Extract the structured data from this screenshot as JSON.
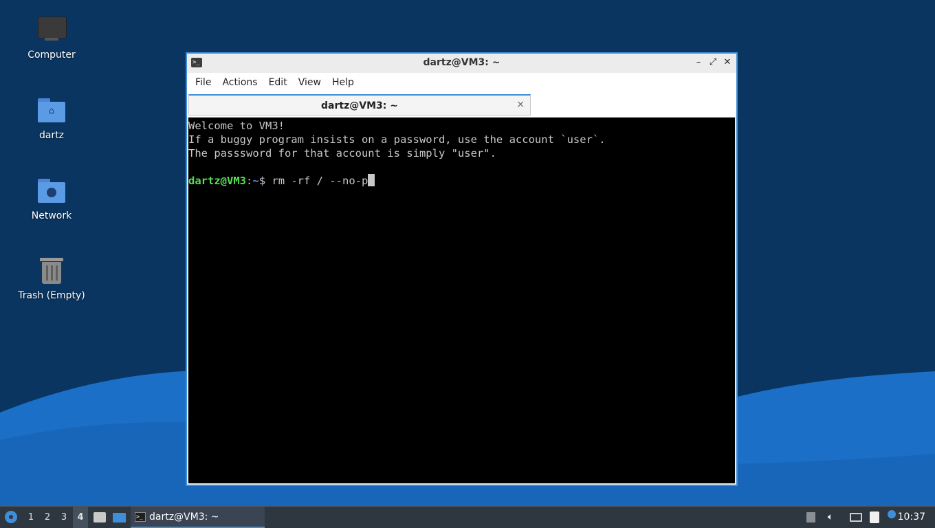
{
  "desktop": {
    "icons": [
      {
        "label": "Computer",
        "icon": "computer-icon"
      },
      {
        "label": "dartz",
        "icon": "home-folder-icon"
      },
      {
        "label": "Network",
        "icon": "network-folder-icon"
      },
      {
        "label": "Trash (Empty)",
        "icon": "trash-icon"
      }
    ]
  },
  "window": {
    "title": "dartz@VM3: ~",
    "controls": {
      "minimize": "–",
      "maximize": "⤢",
      "close": "✕"
    },
    "menu": [
      "File",
      "Actions",
      "Edit",
      "View",
      "Help"
    ],
    "tab": {
      "label": "dartz@VM3: ~",
      "close": "×"
    },
    "terminal": {
      "lines": [
        "Welcome to VM3!",
        "If a buggy program insists on a password, use the account `user`.",
        "The passsword for that account is simply \"user\"."
      ],
      "prompt_user": "dartz@VM3",
      "prompt_sep": ":",
      "prompt_path": "~",
      "prompt_symbol": "$ ",
      "command": "rm -rf / --no-p"
    }
  },
  "taskbar": {
    "workspaces": [
      "1",
      "2",
      "3",
      "4"
    ],
    "active_workspace": "4",
    "task_label": "dartz@VM3: ~",
    "clock": "10:37"
  },
  "colors": {
    "accent": "#3f8fd8",
    "desktop_bg": "#0a3561",
    "prompt_user": "#55e055",
    "prompt_path": "#5b8fe0"
  }
}
